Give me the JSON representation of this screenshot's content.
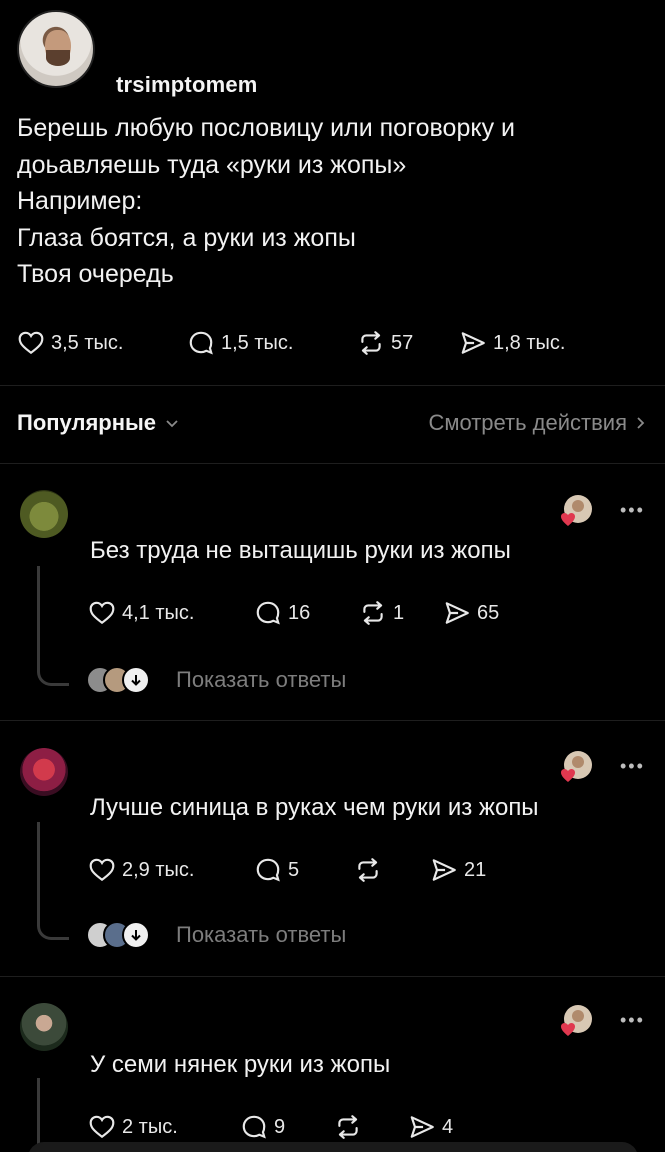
{
  "post": {
    "username": "trsimptomem",
    "text_lines": [
      "Берешь любую пословицу или поговорку и",
      "доьавляешь туда «руки из жопы»",
      "Например:",
      "Глаза боятся, а руки из жопы",
      "Твоя очередь"
    ],
    "likes": "3,5 тыс.",
    "comments": "1,5 тыс.",
    "reposts": "57",
    "shares": "1,8 тыс."
  },
  "sortbar": {
    "sort_label": "Популярные",
    "view_activity": "Смотреть действия"
  },
  "replies": [
    {
      "text": "Без труда не вытащишь руки из жопы",
      "likes": "4,1 тыс.",
      "comments": "16",
      "reposts": "1",
      "shares": "65",
      "show_replies": "Показать ответы"
    },
    {
      "text": "Лучше синица в руках чем руки из жопы",
      "likes": "2,9 тыс.",
      "comments": "5",
      "reposts": "",
      "shares": "21",
      "show_replies": "Показать ответы"
    },
    {
      "text": "У семи нянек руки из жопы",
      "likes": "2 тыс.",
      "comments": "9",
      "reposts": "",
      "shares": "4"
    }
  ],
  "colors": {
    "background": "#000000",
    "text": "#f2f2f2",
    "muted": "#7d7d7d",
    "heart_badge": "#e0384f"
  },
  "icons": [
    "heart-icon",
    "comment-icon",
    "repost-icon",
    "share-icon",
    "chevron-down-icon",
    "chevron-right-icon",
    "more-icon",
    "arrow-down-icon"
  ]
}
